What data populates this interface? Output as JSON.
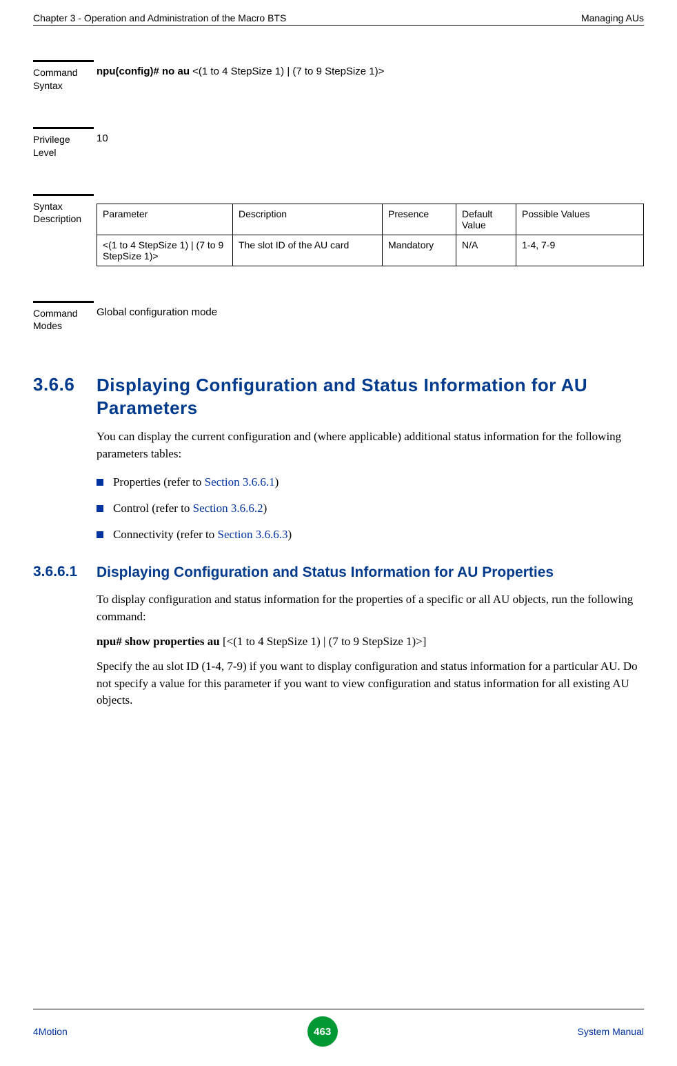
{
  "header": {
    "left": "Chapter 3 - Operation and Administration of the Macro BTS",
    "right": "Managing AUs"
  },
  "blocks": {
    "command_syntax": {
      "label": "Command Syntax",
      "bold": "npu(config)# no au ",
      "rest": "<(1 to 4 StepSize 1) | (7 to 9 StepSize 1)>"
    },
    "privilege": {
      "label": "Privilege Level",
      "value": "10"
    },
    "syntax_desc": {
      "label": "Syntax Description",
      "headers": {
        "param": "Parameter",
        "desc": "Description",
        "pres": "Presence",
        "def": "Default Value",
        "poss": "Possible Values"
      },
      "row": {
        "param": " <(1 to 4 StepSize 1) | (7 to 9 StepSize 1)>",
        "desc": "The slot ID of the AU card",
        "pres": "Mandatory",
        "def": "N/A",
        "poss": "1-4, 7-9"
      }
    },
    "command_modes": {
      "label": "Command Modes",
      "value": "Global configuration mode"
    }
  },
  "h366": {
    "num": "3.6.6",
    "title": "Displaying Configuration and Status Information for AU Parameters",
    "intro": "You can display the current configuration and (where applicable) additional status information for the following parameters tables:",
    "bullets": {
      "b1": {
        "text": "Properties (refer to ",
        "link": "Section 3.6.6.1",
        "after": ")"
      },
      "b2": {
        "text": "Control (refer to ",
        "link": "Section 3.6.6.2",
        "after": ")"
      },
      "b3": {
        "text": "Connectivity (refer to ",
        "link": "Section 3.6.6.3",
        "after": ")"
      }
    }
  },
  "h3661": {
    "num": "3.6.6.1",
    "title": "Displaying Configuration and Status Information for AU Properties",
    "p1": "To display configuration and status information for the properties of a specific or all AU objects, run the following command:",
    "cmd_bold": " npu# show properties au ",
    "cmd_rest": "[<(1 to 4 StepSize 1) | (7 to 9 StepSize 1)>]",
    "p2": "Specify the au slot ID (1-4, 7-9) if you want to display configuration and status information for a particular AU. Do not specify a value for this parameter if you want to view configuration and status information for all existing AU objects."
  },
  "footer": {
    "left": "4Motion",
    "page": "463",
    "right": " System Manual"
  }
}
